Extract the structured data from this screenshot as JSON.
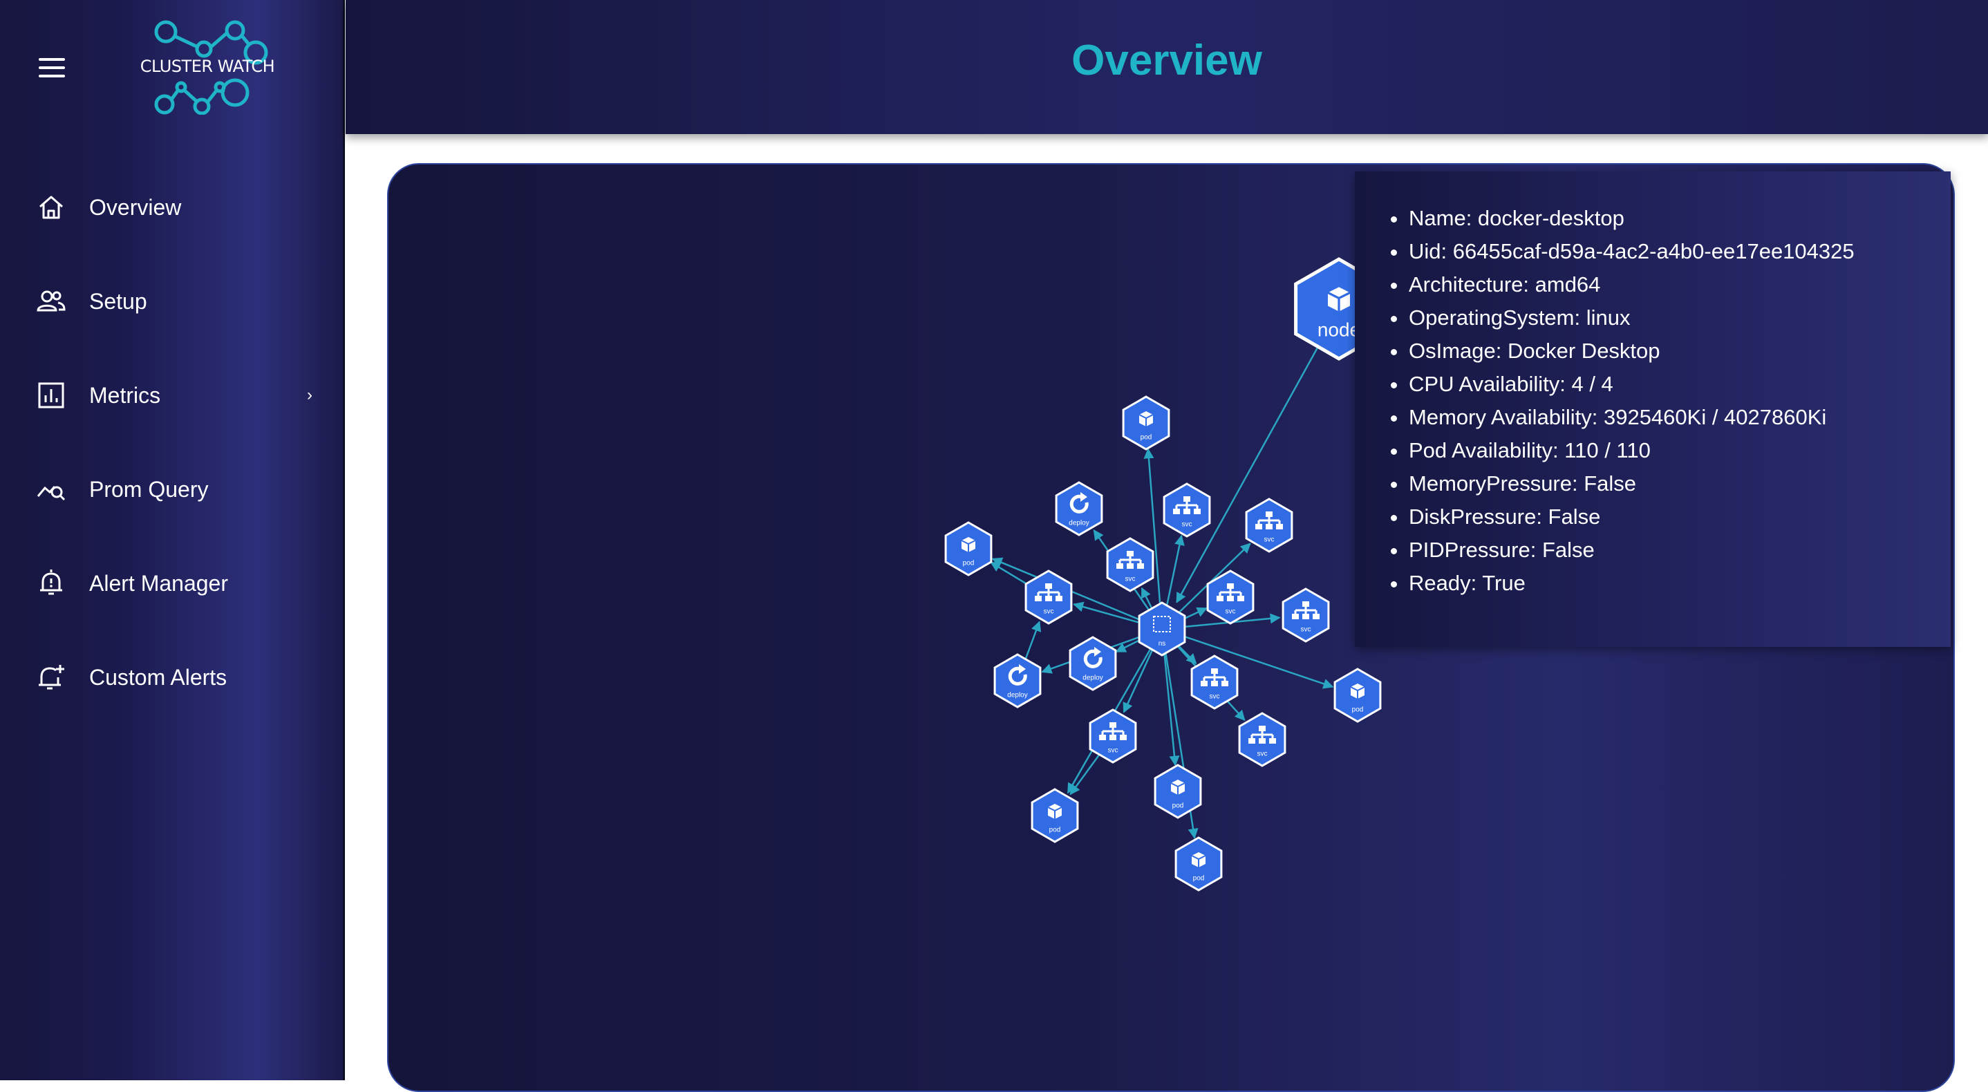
{
  "app": {
    "logo_text": "CLUSTER WATCH"
  },
  "header": {
    "title": "Overview"
  },
  "sidebar": {
    "items": [
      {
        "label": "Overview",
        "icon": "home-icon"
      },
      {
        "label": "Setup",
        "icon": "users-icon"
      },
      {
        "label": "Metrics",
        "icon": "bar-chart-icon",
        "arrow": "›"
      },
      {
        "label": "Prom Query",
        "icon": "query-chart-icon"
      },
      {
        "label": "Alert Manager",
        "icon": "bell-alarm-icon"
      },
      {
        "label": "Custom Alerts",
        "icon": "bell-plus-icon"
      }
    ]
  },
  "graph": {
    "namespace_label": "ns",
    "node_label": "node",
    "pod_label": "pod",
    "svc_label": "svc",
    "deploy_label": "deploy"
  },
  "node_info": [
    "Name: docker-desktop",
    "Uid: 66455caf-d59a-4ac2-a4b0-ee17ee104325",
    "Architecture: amd64",
    "OperatingSystem: linux",
    "OsImage: Docker Desktop",
    "CPU Availability: 4 / 4",
    "Memory Availability: 3925460Ki / 4027860Ki",
    "Pod Availability: 110 / 110",
    "MemoryPressure: False",
    "DiskPressure: False",
    "PIDPressure: False",
    "Ready: True"
  ],
  "colors": {
    "accent": "#20b4c9",
    "node_fill": "#326ce5",
    "edge": "#2aa5c2"
  }
}
